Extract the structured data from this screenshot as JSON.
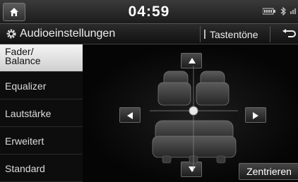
{
  "status": {
    "time": "04:59"
  },
  "header": {
    "title": "Audioeinstellungen",
    "tone_button": "Tastentöne"
  },
  "sidebar": {
    "items": [
      {
        "label": "Fader/\nBalance",
        "active": true
      },
      {
        "label": "Equalizer",
        "active": false
      },
      {
        "label": "Lautstärke",
        "active": false
      },
      {
        "label": "Erweitert",
        "active": false
      },
      {
        "label": "Standard",
        "active": false
      }
    ]
  },
  "main": {
    "center_button": "Zentrieren",
    "fader_balance_position": {
      "balance": 0,
      "fader": 0
    }
  },
  "icons": [
    "home-icon",
    "usb-icon",
    "bluetooth-icon",
    "gear-icon",
    "back-icon",
    "arrow-up-icon",
    "arrow-down-icon",
    "arrow-left-icon",
    "arrow-right-icon"
  ],
  "colors": {
    "active_tab_bg": "#e6e6e6",
    "accent": "#ffffff"
  }
}
